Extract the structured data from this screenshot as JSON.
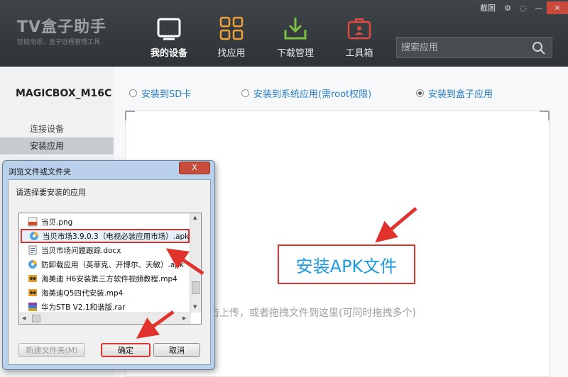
{
  "app": {
    "logo": "TV盒子助手",
    "logo_sub": "智能电视，盒子远程管理工具",
    "screenshot_label": "截图"
  },
  "nav": [
    {
      "label": "我的设备",
      "icon": "tablet-icon"
    },
    {
      "label": "找应用",
      "icon": "grid-icon"
    },
    {
      "label": "下载管理",
      "icon": "download-icon"
    },
    {
      "label": "工具箱",
      "icon": "toolbox-icon"
    }
  ],
  "search": {
    "placeholder": "搜索应用"
  },
  "sidebar": {
    "device_name": "MAGICBOX_M16C",
    "items": [
      {
        "label": "连接设备"
      },
      {
        "label": "安装应用"
      }
    ]
  },
  "main": {
    "options": [
      {
        "label": "安装到SD卡",
        "selected": false
      },
      {
        "label": "安装到系统应用(需root权限)",
        "selected": false
      },
      {
        "label": "安装到盒子应用",
        "selected": true
      }
    ],
    "install_button": "安装APK文件",
    "drop_hint": "击上传，或者拖拽文件到这里(可同时拖拽多个)"
  },
  "dialog": {
    "title": "浏览文件或文件夹",
    "close_label": "X",
    "prompt": "请选择要安装的应用",
    "files": [
      {
        "name": "当贝.png",
        "icon": "png-file-icon"
      },
      {
        "name": "当贝市场3.9.0.3（电视必装应用市场）.apk",
        "icon": "apk-file-icon",
        "selected": true
      },
      {
        "name": "当贝市场问题跟踪.docx",
        "icon": "doc-file-icon"
      },
      {
        "name": "防卸载应用（英菲克、开博尔、天敏）.apk",
        "icon": "apk-file-icon"
      },
      {
        "name": "海美迪 H6安装第三方软件视频教程.mp4",
        "icon": "video-file-icon"
      },
      {
        "name": "海美迪Q5四代安装.mp4",
        "icon": "video-file-icon"
      },
      {
        "name": "华为STB V2.1和谐版.rar",
        "icon": "rar-file-icon"
      }
    ],
    "new_folder_button": "新建文件夹(M)",
    "ok_button": "确定",
    "cancel_button": "取消"
  },
  "colors": {
    "accent_blue": "#1e9be0",
    "highlight_red": "#e0332e",
    "header_bg": "#33383c"
  }
}
